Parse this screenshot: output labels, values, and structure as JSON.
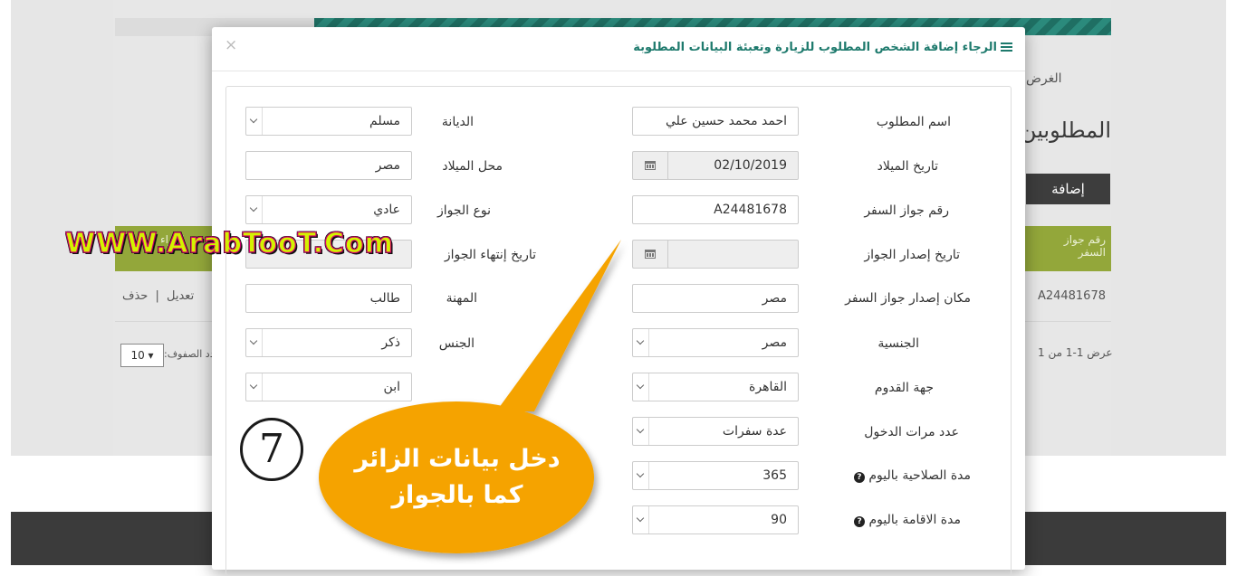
{
  "background": {
    "purpose_label": "الغرض",
    "section_title": "المطلوبين",
    "add_button": "إضافة",
    "table_header": "رقم جواز السفر",
    "table_header_partial": "إجراء",
    "row_passport": "A24481678",
    "row_edit": "تعديل",
    "row_sep": "|",
    "row_delete": "حذف",
    "pager_summary": "عرض 1-1 من 1",
    "rows_label": "عدد الصفوف:",
    "rows_value": "10"
  },
  "modal": {
    "title": "الرجاء إضافة الشخص المطلوب للزيارة وتعبئة البيانات المطلوبة",
    "close": "×"
  },
  "form": {
    "name": {
      "label": "اسم المطلوب",
      "value": "احمد محمد حسين علي"
    },
    "birth_date": {
      "label": "تاريخ الميلاد",
      "value": "02/10/2019"
    },
    "passport_no": {
      "label": "رقم جواز السفر",
      "value": "A24481678"
    },
    "passport_issue_date": {
      "label": "تاريخ إصدار الجواز",
      "value": ""
    },
    "passport_issue_place": {
      "label": "مكان إصدار جواز السفر",
      "value": "مصر"
    },
    "nationality": {
      "label": "الجنسية",
      "value": "مصر"
    },
    "arrival_from": {
      "label": "جهة القدوم",
      "value": "القاهرة"
    },
    "entries": {
      "label": "عدد مرات الدخول",
      "value": "عدة سفرات"
    },
    "validity_days": {
      "label": "مدة الصلاحية باليوم",
      "value": "365"
    },
    "stay_days": {
      "label": "مدة الاقامة باليوم",
      "value": "90"
    },
    "religion": {
      "label": "الديانة",
      "value": "مسلم"
    },
    "birth_place": {
      "label": "محل الميلاد",
      "value": "مصر"
    },
    "passport_type": {
      "label": "نوع الجواز",
      "value": "عادي"
    },
    "passport_expiry": {
      "label": "تاريخ إنتهاء الجواز",
      "value": ""
    },
    "profession": {
      "label": "المهنة",
      "value": "طالب"
    },
    "gender": {
      "label": "الجنس",
      "value": "ذكر"
    },
    "relation": {
      "label": "",
      "value": "ابن"
    }
  },
  "overlay": {
    "watermark": "WWW.ArabTooT.Com",
    "callout_line1": "دخل بيانات الزائر",
    "callout_line2": "كما بالجواز",
    "step_number": "7",
    "callout_color": "#f5a300"
  }
}
